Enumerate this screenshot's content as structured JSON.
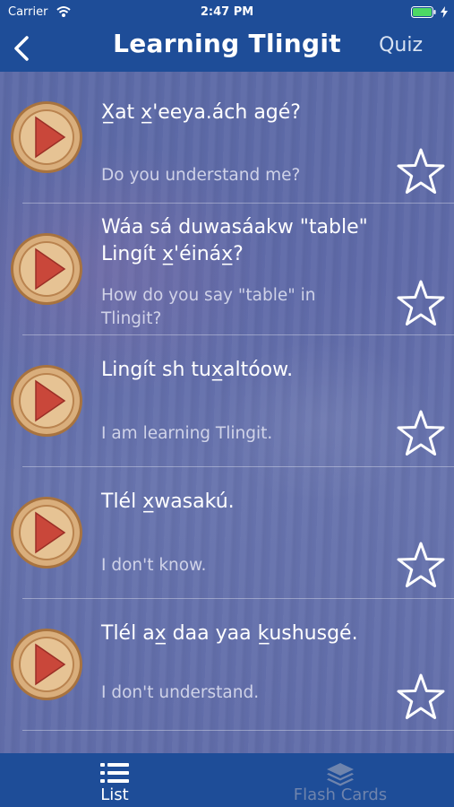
{
  "status_bar": {
    "carrier": "Carrier",
    "time": "2:47 PM"
  },
  "nav": {
    "title": "Learning Tlingit",
    "quiz_label": "Quiz"
  },
  "phrases": [
    {
      "tlingit": "X̲at x̲'eeya.ách agé?",
      "english": "Do you understand me?",
      "favorited": false
    },
    {
      "tlingit": "Wáa sá duwasáakw \"table\" Lingít x̲'éináx̲?",
      "english": "How do you say \"table\" in Tlingit?",
      "favorited": false
    },
    {
      "tlingit": "Lingít sh tux̲altóow.",
      "english": "I am learning Tlingit.",
      "favorited": false
    },
    {
      "tlingit": "Tlél x̲wasakú.",
      "english": "I don't know.",
      "favorited": false
    },
    {
      "tlingit": "Tlél ax̲ daa yaa k̲ushusgé.",
      "english": "I don't understand.",
      "favorited": false
    }
  ],
  "tabs": [
    {
      "label": "List",
      "icon": "list-icon",
      "active": true
    },
    {
      "label": "Flash Cards",
      "icon": "stack-icon",
      "active": false
    }
  ],
  "colors": {
    "bar": "#1e4d98",
    "play_fill": "#c94a3a",
    "play_rim": "#b8804e"
  }
}
